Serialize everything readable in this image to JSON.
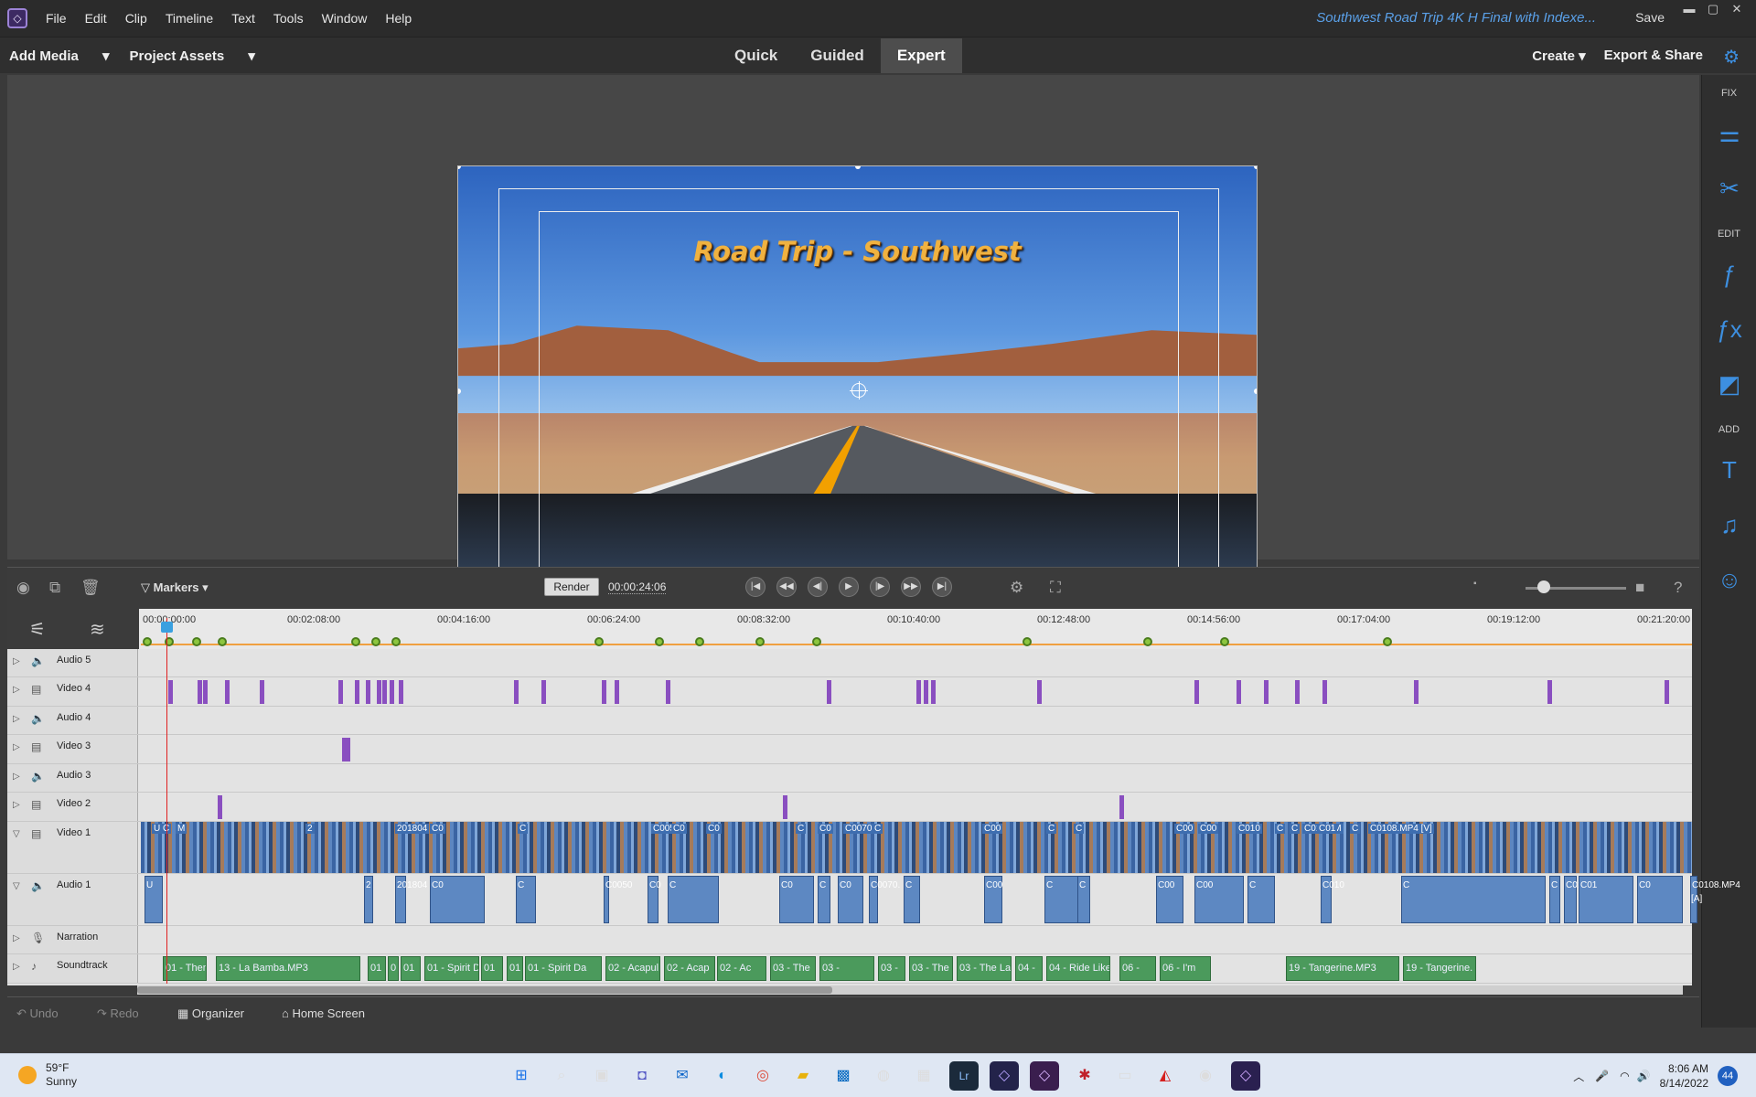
{
  "app": {
    "menu": [
      "File",
      "Edit",
      "Clip",
      "Timeline",
      "Text",
      "Tools",
      "Window",
      "Help"
    ],
    "document_title": "Southwest Road Trip 4K H Final with Indexe...",
    "save_label": "Save"
  },
  "toolbar": {
    "add_media": "Add Media",
    "project_assets": "Project Assets",
    "modes": [
      "Quick",
      "Guided",
      "Expert"
    ],
    "active_mode": "Expert",
    "create": "Create",
    "export_share": "Export & Share"
  },
  "preview": {
    "title_text": "Road Trip - Southwest"
  },
  "right_panel": {
    "fix_label": "FIX",
    "edit_label": "EDIT",
    "add_label": "ADD"
  },
  "transport": {
    "markers_label": "Markers",
    "render_label": "Render",
    "timecode": "00:00:24:06"
  },
  "ruler": {
    "ticks": [
      "00:00:00:00",
      "00:02:08:00",
      "00:04:16:00",
      "00:06:24:00",
      "00:08:32:00",
      "00:10:40:00",
      "00:12:48:00",
      "00:14:56:00",
      "00:17:04:00",
      "00:19:12:00",
      "00:21:20:00"
    ]
  },
  "tracks": [
    {
      "name": "Audio 5",
      "type": "audio"
    },
    {
      "name": "Video 4",
      "type": "video"
    },
    {
      "name": "Audio 4",
      "type": "audio"
    },
    {
      "name": "Video 3",
      "type": "video"
    },
    {
      "name": "Audio 3",
      "type": "audio"
    },
    {
      "name": "Video 2",
      "type": "video"
    },
    {
      "name": "Video 1",
      "type": "video"
    },
    {
      "name": "Audio 1",
      "type": "audio"
    },
    {
      "name": "Narration",
      "type": "narration"
    },
    {
      "name": "Soundtrack",
      "type": "soundtrack"
    }
  ],
  "video1_labels": [
    "U",
    "C",
    "M",
    "2",
    "201804",
    "C0",
    "C",
    "C005",
    "C0",
    "C0",
    "C",
    "C0",
    "C0070.",
    "C",
    "C00",
    "C",
    "C",
    "C00",
    "C00",
    "C010",
    "C",
    "C",
    "C0105.M",
    "C01",
    "C",
    "C0108.MP4 [V]"
  ],
  "audio1_labels": [
    "U",
    "2",
    "201804",
    "C0",
    "C",
    "C0050",
    "C0",
    "C",
    "C0",
    "C",
    "C0",
    "C0070.",
    "C",
    "C00",
    "C",
    "C",
    "C00",
    "C00",
    "C",
    "C010",
    "C",
    "C",
    "C0105.M",
    "C01",
    "C0",
    "C0108.MP4 [A]"
  ],
  "soundtrack_clips": [
    "01 - Them",
    "13 - La Bamba.MP3",
    "01",
    "0",
    "01",
    "01 - Spirit D",
    "01",
    "01",
    "01 - Spirit Da",
    "02 - Acapul",
    "02 - Acap",
    "02 - Ac",
    "03 - The",
    "03 -",
    "03 -",
    "03 - The",
    "03 - The Last",
    "04 -",
    "04 - Ride Like Th",
    "06 -",
    "06 - I'm",
    "19 - Tangerine.MP3",
    "19 - Tangerine."
  ],
  "bottom": {
    "undo": "Undo",
    "redo": "Redo",
    "organizer": "Organizer",
    "home_screen": "Home Screen"
  },
  "taskbar": {
    "temp": "59°F",
    "weather": "Sunny",
    "time": "8:06 AM",
    "date": "8/14/2022",
    "notifications": "44"
  },
  "colors": {
    "accent": "#3d8fe0",
    "clip_marker": "#8a4fc0",
    "soundtrack": "#4b9a5c",
    "playhead": "#e02020"
  }
}
